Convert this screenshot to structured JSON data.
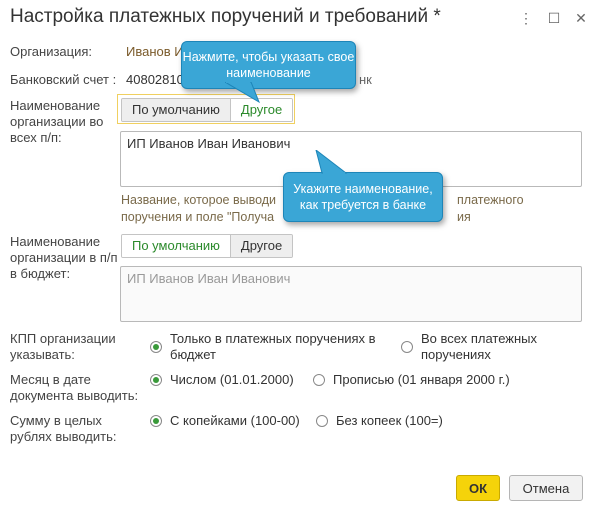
{
  "window": {
    "title": "Настройка платежных поручений и требований *",
    "more_icon": "⋮",
    "maximize_icon": "☐",
    "close_icon": "✕"
  },
  "fields": {
    "org_label": "Организация:",
    "org_value": "Иванов И",
    "bank_label": "Банковский счет :",
    "bank_value_left": "40802810",
    "bank_value_right": "нк",
    "name_all_label": "Наименование организации во всех п/п:",
    "name_all_seg_default": "По умолчанию",
    "name_all_seg_other": "Другое",
    "name_all_value": "ИП Иванов Иван Иванович",
    "name_all_hint_line1": "Название, которое выводи",
    "name_all_hint_line1_end": "платежного",
    "name_all_hint_line2": "поручения и поле \"Получа",
    "name_all_hint_line2_end": "ия",
    "name_budget_label": "Наименование организации в п/п в бюджет:",
    "name_budget_seg_default": "По умолчанию",
    "name_budget_seg_other": "Другое",
    "name_budget_value": "ИП Иванов Иван Иванович",
    "kpp_label": "КПП организации указывать:",
    "kpp_opt1": "Только в платежных поручениях в бюджет",
    "kpp_opt2": "Во всех платежных поручениях",
    "month_label": "Месяц в дате документа выводить:",
    "month_opt1": "Числом (01.01.2000)",
    "month_opt2": "Прописью (01 января 2000 г.)",
    "sum_label": "Сумму в целых рублях выводить:",
    "sum_opt1": "С копейками (100-00)",
    "sum_opt2": "Без копеек (100=)"
  },
  "tooltips": {
    "tip1": "Нажмите, чтобы указать свое наименование",
    "tip2": "Укажите наименование, как требуется в банке"
  },
  "buttons": {
    "ok": "ОК",
    "cancel": "Отмена"
  },
  "colors": {
    "accent_green": "#3a9a3a",
    "tooltip_blue": "#3aa6d6",
    "ok_yellow": "#f5d30a"
  }
}
